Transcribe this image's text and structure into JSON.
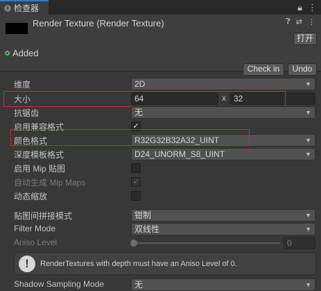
{
  "tab": {
    "label": "检查器",
    "lock_icon": "lock-icon",
    "menu_icon": "menu-icon"
  },
  "header": {
    "title": "Render Texture (Render Texture)",
    "open_label": "打开",
    "added_label": "Added",
    "checkin_label": "Check in",
    "undo_label": "Undo"
  },
  "props": {
    "dimension": {
      "label": "维度",
      "value": "2D"
    },
    "size": {
      "label": "大小",
      "width": "64",
      "sep": "x",
      "height": "32"
    },
    "antialias": {
      "label": "抗锯齿",
      "value": "无"
    },
    "compat_format": {
      "label": "启用兼容格式",
      "checked": true
    },
    "color_format": {
      "label": "颜色格式",
      "value": "R32G32B32A32_UINT"
    },
    "depth_format": {
      "label": "深度模板格式",
      "value": "D24_UNORM_S8_UINT"
    },
    "mipmap": {
      "label": "启用 Mip 贴图",
      "checked": false
    },
    "auto_mip": {
      "label": "自动生成 Mip Maps",
      "checked": true
    },
    "dynamic_scale": {
      "label": "动态缩放",
      "checked": false
    },
    "wrap_mode": {
      "label": "贴图间拼接模式",
      "value": "钳制"
    },
    "filter_mode": {
      "label": "Filter Mode",
      "value": "双线性"
    },
    "aniso": {
      "label": "Aniso Level",
      "value": "0",
      "slider_fraction": 0
    },
    "help": "RenderTextures with depth must have an Aniso Level of 0.",
    "shadow_sampling": {
      "label": "Shadow Sampling Mode",
      "value": "无"
    }
  },
  "colors": {
    "accent": "#3a79bb",
    "highlight_box": "#cf2c2c",
    "added": "#4ec25b"
  }
}
